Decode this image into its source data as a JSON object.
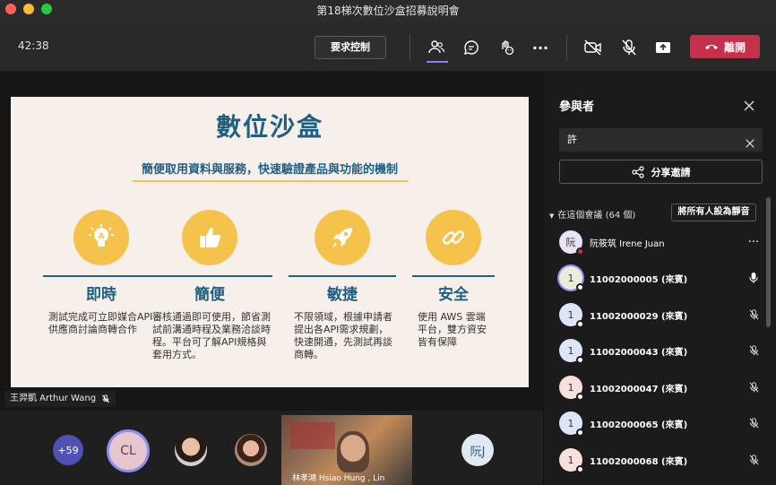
{
  "window": {
    "title": "第18梯次數位沙盒招募說明會"
  },
  "toolbar": {
    "timer": "42:38",
    "request_control": "要求控制",
    "leave": "離開"
  },
  "slide": {
    "title": "數位沙盒",
    "subtitle": "簡便取用資料與服務，快速驗證產品與功能的機制",
    "features": [
      {
        "icon": "lightbulb-icon",
        "heading": "即時",
        "body": "測試完成可立即媒合API供應商討論商轉合作"
      },
      {
        "icon": "thumbs-up-icon",
        "heading": "簡便",
        "body": "審核通過即可使用，節省測試前溝通時程及業務洽談時程。平台可了解API規格與套用方式。"
      },
      {
        "icon": "rocket-icon",
        "heading": "敏捷",
        "body": "不限領域，根據申請者提出各API需求規劃，快速開通，先測試再談商轉。"
      },
      {
        "icon": "link-icon",
        "heading": "安全",
        "body": "使用 AWS 雲端平台，雙方資安皆有保障"
      }
    ]
  },
  "presenter": {
    "name": "王羿凱 Arthur Wang"
  },
  "gallery": {
    "overflow_count": "+59",
    "cl_initials": "CL",
    "video_name": "林孝鴻 Hsiao Hung , Lin",
    "ruan_initials": "阮J"
  },
  "panel": {
    "title": "參與者",
    "search_value": "許",
    "share_invite": "分享邀請",
    "section_label": "在這個會議 (64 個)",
    "mute_all": "將所有人設為靜音",
    "participants": [
      {
        "initials": "阮",
        "name": "阮筱筑 Irene Juan",
        "action": "more",
        "avatar_color": "#e8e3f5"
      },
      {
        "initials": "1",
        "name": "11002000005 (來賓)",
        "action": "mic-on",
        "avatar_color": "#eaeed9"
      },
      {
        "initials": "1",
        "name": "11002000029 (來賓)",
        "action": "mic-off",
        "avatar_color": "#dde6f7"
      },
      {
        "initials": "1",
        "name": "11002000043 (來賓)",
        "action": "mic-off",
        "avatar_color": "#dde6f7"
      },
      {
        "initials": "1",
        "name": "11002000047 (來賓)",
        "action": "mic-off",
        "avatar_color": "#f7e0dc"
      },
      {
        "initials": "1",
        "name": "11002000065 (來賓)",
        "action": "mic-off",
        "avatar_color": "#dde6f7"
      },
      {
        "initials": "1",
        "name": "11002000068 (來賓)",
        "action": "mic-off",
        "avatar_color": "#f7e0dc"
      }
    ]
  },
  "colors": {
    "accent": "#5b5fc7",
    "leave": "#c4314b",
    "slide_blue": "#1f5f82",
    "slide_yellow": "#f5c24c"
  }
}
